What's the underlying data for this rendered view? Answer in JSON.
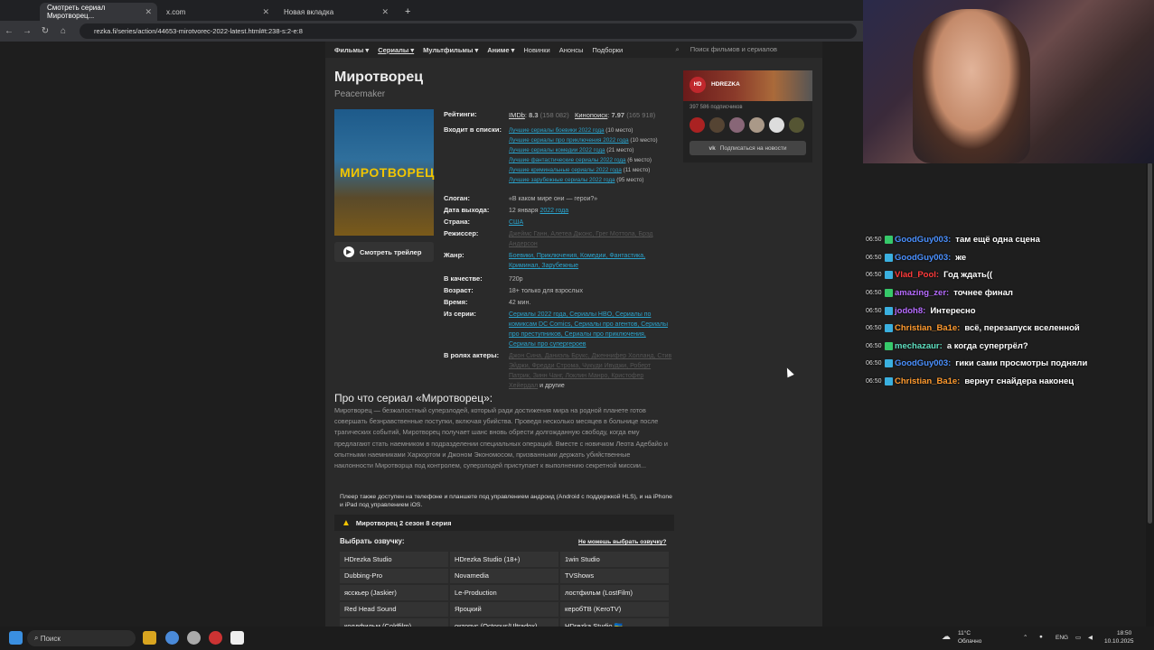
{
  "browser": {
    "tabs": [
      {
        "label": "Смотреть сериал Миротворец..."
      },
      {
        "label": "x.com"
      },
      {
        "label": "Новая вкладка"
      }
    ],
    "url": "rezka.fi/series/action/44653-mirotvorec-2022-latest.html#t:238-s:2-e:8"
  },
  "site": {
    "nav": [
      "Фильмы ▾",
      "Сериалы ▾",
      "Мультфильмы ▾",
      "Аниме ▾",
      "Новинки",
      "Анонсы",
      "Подборки"
    ],
    "search_placeholder": "Поиск фильмов и сериалов",
    "title": "Миротворец",
    "original_title": "Peacemaker",
    "poster_text": "МИРОТВОРЕЦ",
    "trailer_label": "Смотреть трейлер",
    "ratings_label": "Рейтинги:",
    "imdb": {
      "name": "IMDb",
      "score": "8.3",
      "votes": "(158 082)"
    },
    "kp": {
      "name": "Кинопоиск",
      "score": "7.97",
      "votes": "(165 918)"
    },
    "lists_label": "Входит в списки:",
    "lists": [
      {
        "text": "Лучшие сериалы боевики 2022 года",
        "place": "(10 место)"
      },
      {
        "text": "Лучшие сериалы про приключения 2022 года",
        "place": "(10 место)"
      },
      {
        "text": "Лучшие сериалы комедии 2022 года",
        "place": "(21 место)"
      },
      {
        "text": "Лучшие фантастические сериалы 2022 года",
        "place": "(6 место)"
      },
      {
        "text": "Лучшие криминальные сериалы 2022 года",
        "place": "(11 место)"
      },
      {
        "text": "Лучшие зарубежные сериалы 2022 года",
        "place": "(95 место)"
      }
    ],
    "slogan_label": "Слоган:",
    "slogan": "«В каком мире они — герои?»",
    "release_label": "Дата выхода:",
    "release_day": "12 января",
    "release_year": "2022 года",
    "country_label": "Страна:",
    "country": "США",
    "director_label": "Режиссер:",
    "directors": "Джеймс Ганн, Алетеа Джонс, Грег Моттола, Брэд Андерсон",
    "genre_label": "Жанр:",
    "genres": "Боевики, Приключения, Комедии, Фантастика, Криминал, Зарубежные",
    "quality_label": "В качестве:",
    "quality": "720p",
    "age_label": "Возраст:",
    "age": "18+ только для взрослых",
    "time_label": "Время:",
    "time": "42 мин.",
    "series_label": "Из серии:",
    "series_from": "Сериалы 2022 года, Сериалы HBO, Сериалы по комиксам DC Comics, Сериалы про агентов, Сериалы про преступников, Сериалы про приключения, Сериалы про супергероев",
    "actors_label": "В ролях актеры:",
    "actors": "Джон Сина, Даниэль Брукс, Дженнифер Холланд, Стив Эйджи, Фредди Строма, Чукуди Ивуджи, Роберт Патрик, Зинн Чанг, Локлин Манро, Кристофер Хейердал",
    "actors_more": "и другие",
    "channel": {
      "name": "HDREZKA",
      "logo": "HD",
      "subs": "397 586 подписчиков",
      "button": "Подписаться на новости"
    },
    "desc_heading": "Про что сериал «Миротворец»:",
    "desc": "Миротворец — безжалостный суперзлодей, который ради достижения мира на родной планете готов совершать безнравственные поступки, включая убийства. Проведя несколько месяцев в больнице после трагических событий, Миротворец получает шанс вновь обрести долгожданную свободу, когда ему предлагают стать наемником в подразделении специальных операций. Вместе с новичком Леота Адебайо и опытными наемниками Харкортом и Джоном Экономосом, призванными держать убийственные наклонности Миротворца под контролем, суперзлодей приступает к выполнению секретной миссии...",
    "player_note": "Плеер также доступен на телефоне и планшете под управлением андроид (Android с поддержкой HLS), и на iPhone и iPad под управлением iOS.",
    "episode_warn": "Миротворец 2 сезон 8 серия",
    "voice_heading": "Выбрать озвучку:",
    "voice_help": "Не можешь выбрать озвучку?",
    "voices": [
      "HDrezka Studio",
      "HDrezka Studio (18+)",
      "1win Studio",
      "Dubbing-Pro",
      "Novamedia",
      "TVShows",
      "ясскьер (Jaskier)",
      "Le-Production",
      "лостфильм (LostFilm)",
      "Red Head Sound",
      "Яроцкий",
      "керобТВ (KeroTV)",
      "колдфильм (Coldfilm)",
      "октопус (Octopus/Ultradox)",
      "HDrezka Studio 🇺🇦"
    ]
  },
  "chat": [
    {
      "time": "06:50",
      "nick": "GoodGuy003",
      "color": "#4a90ff",
      "text": "там ещё одна сцена"
    },
    {
      "time": "06:50",
      "nick": "GoodGuy003",
      "color": "#4a90ff",
      "text": "же"
    },
    {
      "time": "06:50",
      "nick": "Vlad_Pool",
      "color": "#ff3b3b",
      "text": "Год ждать(("
    },
    {
      "time": "06:50",
      "nick": "amazing_zer",
      "color": "#b66bff",
      "text": "точнее финал"
    },
    {
      "time": "06:50",
      "nick": "jodoh8",
      "color": "#b66bff",
      "text": "Интересно"
    },
    {
      "time": "06:50",
      "nick": "Christian_Ba1e",
      "color": "#ff9a2e",
      "text": "всё, перезапуск вселенной"
    },
    {
      "time": "06:50",
      "nick": "mechazaur",
      "color": "#5ee0c0",
      "text": "а когда суперrрёл?"
    },
    {
      "time": "06:50",
      "nick": "GoodGuy003",
      "color": "#4a90ff",
      "text": "гики сами просмотры подняли"
    },
    {
      "time": "06:50",
      "nick": "Christian_Ba1e",
      "color": "#ff9a2e",
      "text": "вернут снайдера наконец"
    }
  ],
  "taskbar": {
    "search": "Поиск",
    "weather_temp": "11°C",
    "weather_text": "Облачно",
    "lang": "ENG",
    "time": "18:50",
    "date": "10.10.2025"
  }
}
